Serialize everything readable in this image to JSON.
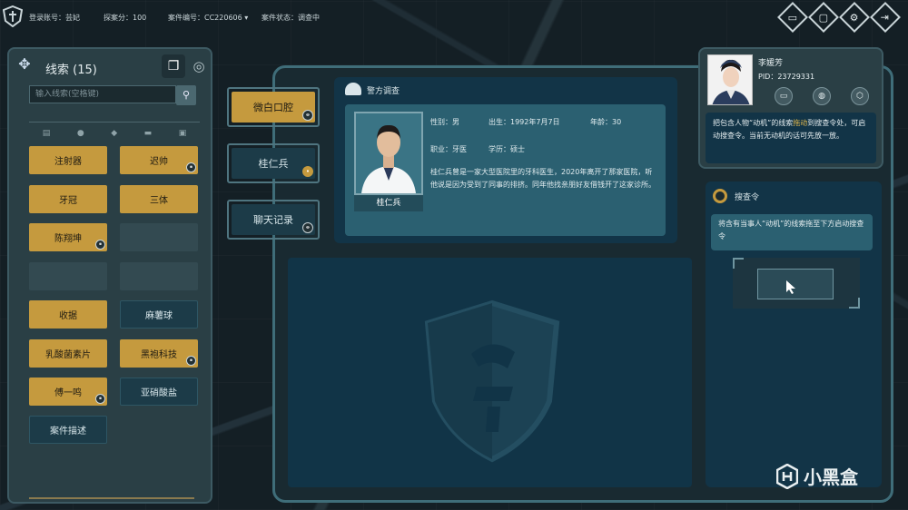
{
  "topbar": {
    "account": "登录账号：芸妃",
    "explore_score": "探案分：100",
    "case_no": "案件编号：CC220606 ▾",
    "case_status": "案件状态：调查中",
    "icons": [
      "id-card-icon",
      "screen-icon",
      "gear-icon",
      "exit-icon"
    ]
  },
  "clue_panel": {
    "title": "线索 (15)",
    "search_placeholder": "输入线索(空格键)",
    "search_icon": "search-icon",
    "filter_icons": [
      "document-icon",
      "person-icon",
      "location-icon",
      "item-icon",
      "note-icon"
    ],
    "clues": [
      {
        "label": "注射器",
        "style": "gold",
        "badge": false
      },
      {
        "label": "迟帅",
        "style": "gold",
        "badge": true
      },
      {
        "label": "牙冠",
        "style": "gold",
        "badge": false
      },
      {
        "label": "三体",
        "style": "gold",
        "badge": false
      },
      {
        "label": "陈翔坤",
        "style": "gold",
        "badge": true
      },
      {
        "label": "",
        "style": "empty",
        "badge": false
      },
      {
        "label": "",
        "style": "empty",
        "badge": false
      },
      {
        "label": "",
        "style": "empty",
        "badge": false
      },
      {
        "label": "收据",
        "style": "gold",
        "badge": false
      },
      {
        "label": "麻薯球",
        "style": "blue",
        "badge": false
      },
      {
        "label": "乳酸菌素片",
        "style": "gold",
        "badge": false
      },
      {
        "label": "黑袍科技",
        "style": "gold",
        "badge": true
      },
      {
        "label": "傅一鸣",
        "style": "gold",
        "badge": true
      },
      {
        "label": "亚硝酸盐",
        "style": "blue",
        "badge": false
      },
      {
        "label": "案件描述",
        "style": "blue",
        "badge": false
      }
    ]
  },
  "tabs": [
    {
      "label": "微白口腔",
      "style": "gold"
    },
    {
      "label": "桂仁兵",
      "style": "blue"
    },
    {
      "label": "聊天记录",
      "style": "blue"
    }
  ],
  "report": {
    "title": "警方调查",
    "name": "桂仁兵",
    "gender": "性别：男",
    "birth": "出生：1992年7月7日",
    "age": "年龄：30",
    "job": "职业：牙医",
    "education": "学历：硕士",
    "description": "桂仁兵曾是一家大型医院里的牙科医生，2020年离开了那家医院，听他说是因为受到了同事的排挤。同年他找亲朋好友借钱开了这家诊所。"
  },
  "officer": {
    "name": "李媛芳",
    "pid": "PID：23729331",
    "icons": [
      "chat-icon",
      "profile-icon",
      "badge-icon"
    ],
    "message_before": "把包含人物“动机”的线索",
    "message_highlight": "拖动",
    "message_after": "到搜查令处，可启动搜查令。当前无动机的话可先放一放。"
  },
  "search_order": {
    "title": "搜查令",
    "message": "将含有当事人“动机”的线索拖至下方启动搜查令"
  },
  "watermark": {
    "text": "小黑盒"
  },
  "colors": {
    "gold": "#c59a3e",
    "blue_panel": "#123447",
    "frame": "#3f6d79"
  }
}
